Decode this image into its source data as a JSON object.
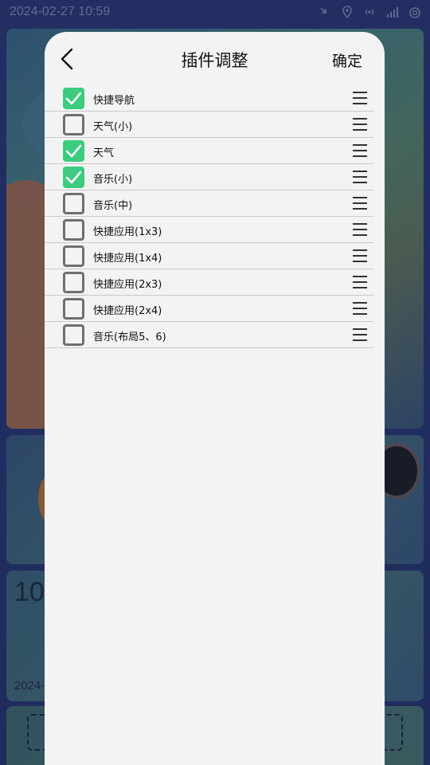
{
  "status_bar": {
    "datetime": "2024-02-27 10:59",
    "icons": [
      "missed-call-icon",
      "location-icon",
      "hotspot-icon",
      "signal-icon",
      "settings-icon"
    ]
  },
  "background": {
    "clock_partial": "10",
    "date_partial": "2024-"
  },
  "dialog": {
    "title": "插件调整",
    "back_icon": "chevron-left-icon",
    "confirm_label": "确定",
    "items": [
      {
        "label": "快捷导航",
        "checked": true
      },
      {
        "label": "天气(小)",
        "checked": false
      },
      {
        "label": "天气",
        "checked": true
      },
      {
        "label": "音乐(小)",
        "checked": true
      },
      {
        "label": "音乐(中)",
        "checked": false
      },
      {
        "label": "快捷应用(1x3)",
        "checked": false
      },
      {
        "label": "快捷应用(1x4)",
        "checked": false
      },
      {
        "label": "快捷应用(2x3)",
        "checked": false
      },
      {
        "label": "快捷应用(2x4)",
        "checked": false
      },
      {
        "label": "音乐(布局5、6)",
        "checked": false
      }
    ]
  },
  "colors": {
    "checkbox_on": "#3ccb7f",
    "panel_bg": "#f3f3f3"
  }
}
